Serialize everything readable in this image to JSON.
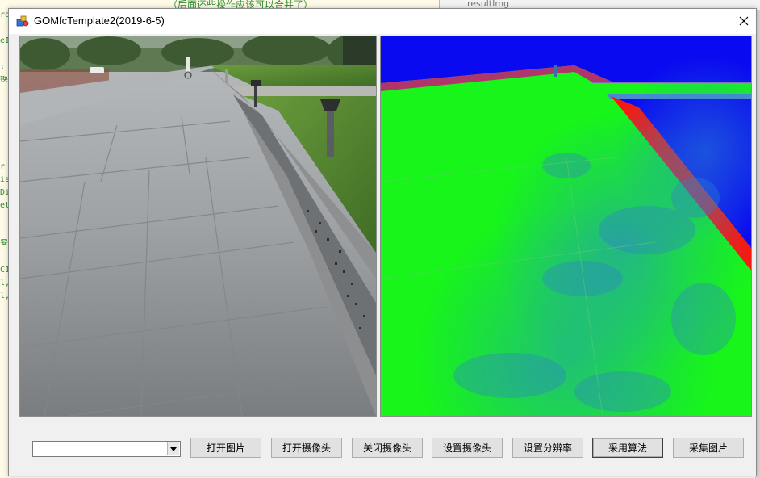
{
  "background": {
    "editor_code_line": "（后面还些操作应该可以合并了）",
    "editor_right_text": "resultImg",
    "gutter_fragments": [
      "ro",
      "eI",
      ":",
      "换",
      "r",
      "is",
      "Di",
      "et",
      "要",
      "C1",
      "l,",
      "l,"
    ]
  },
  "window": {
    "title": "GOMfcTemplate2(2019-6-5)",
    "icon": "mfc-app-icon",
    "close_icon": "close-icon"
  },
  "toolbar": {
    "combo_value": "",
    "buttons": [
      {
        "label": "打开图片"
      },
      {
        "label": "打开摄像头"
      },
      {
        "label": "关闭摄像头"
      },
      {
        "label": "设置摄像头"
      },
      {
        "label": "设置分辨率"
      },
      {
        "label": "采用算法",
        "default": true
      },
      {
        "label": "采集图片"
      }
    ]
  },
  "panes": {
    "left": {
      "content": "camera-frame-sidewalk"
    },
    "right": {
      "content": "segmentation-result-map"
    }
  },
  "colors": {
    "segmentation_green": "#17f51a",
    "segmentation_blue": "#0a0af0",
    "segmentation_red": "#f51a10",
    "title_bg": "#ffffff",
    "client_bg": "#f0f0f0"
  }
}
